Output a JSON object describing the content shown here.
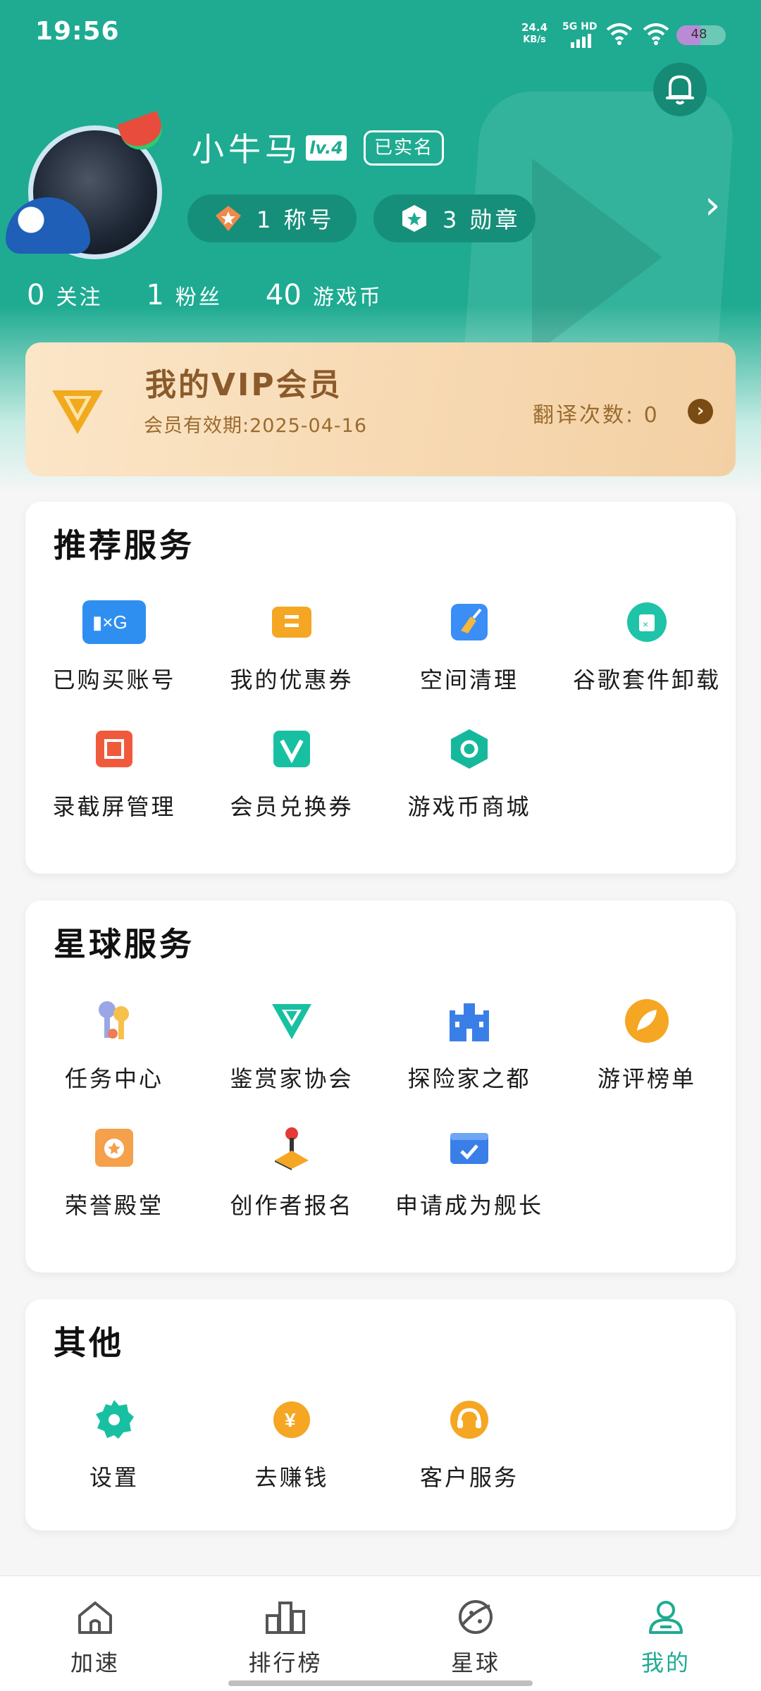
{
  "status_bar": {
    "time": "19:56",
    "net_speed_value": "24.4",
    "net_speed_unit": "KB/s",
    "signal_label": "5G HD",
    "battery": "48"
  },
  "profile": {
    "username": "小牛马",
    "level": "lv.4",
    "verified": "已实名",
    "accounts_pill": "1 称号",
    "medals_pill": "3 勋章",
    "stats": [
      {
        "value": "0",
        "label": "关注"
      },
      {
        "value": "1",
        "label": "粉丝"
      },
      {
        "value": "40",
        "label": "游戏币"
      }
    ]
  },
  "vip": {
    "title": "我的VIP会员",
    "expiry": "会员有效期:2025-04-16",
    "translate_count": "翻译次数: 0"
  },
  "sections": {
    "recommended": {
      "title": "推荐服务",
      "items": [
        "已购买账号",
        "我的优惠券",
        "空间清理",
        "谷歌套件卸载",
        "录截屏管理",
        "会员兑换券",
        "游戏币商城"
      ]
    },
    "planet": {
      "title": "星球服务",
      "items": [
        "任务中心",
        "鉴赏家协会",
        "探险家之都",
        "游评榜单",
        "荣誉殿堂",
        "创作者报名",
        "申请成为舰长"
      ]
    },
    "other": {
      "title": "其他",
      "items": [
        "设置",
        "去赚钱",
        "客户服务"
      ]
    }
  },
  "tabbar": {
    "tabs": [
      "加速",
      "排行榜",
      "星球",
      "我的"
    ],
    "active": "我的"
  },
  "colors": {
    "primary": "#1eab91",
    "vip_text": "#8b5a2b"
  }
}
